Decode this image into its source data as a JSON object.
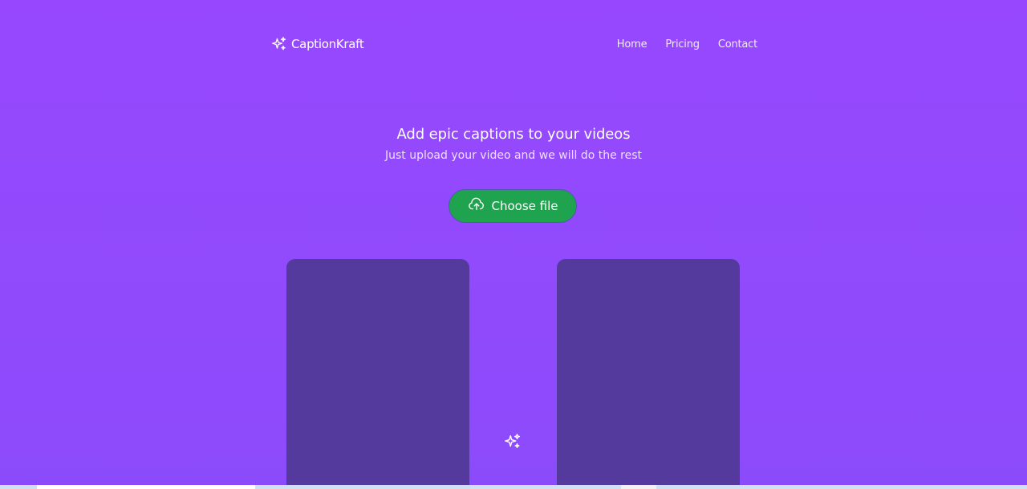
{
  "brand": {
    "name": "CaptionKraft",
    "icon": "sparkles-icon"
  },
  "nav": {
    "items": [
      {
        "label": "Home"
      },
      {
        "label": "Pricing"
      },
      {
        "label": "Contact"
      }
    ]
  },
  "hero": {
    "title": "Add epic captions to your videos",
    "subtitle": "Just upload your video and we will do the rest"
  },
  "upload": {
    "label": "Choose file",
    "icon": "cloud-upload-icon"
  },
  "preview": {
    "separator_icon": "sparkles-icon"
  },
  "colors": {
    "background": "#9748fe",
    "accent_button": "#1fa34f",
    "panel": "#533a9c",
    "text": "#ffffff"
  }
}
